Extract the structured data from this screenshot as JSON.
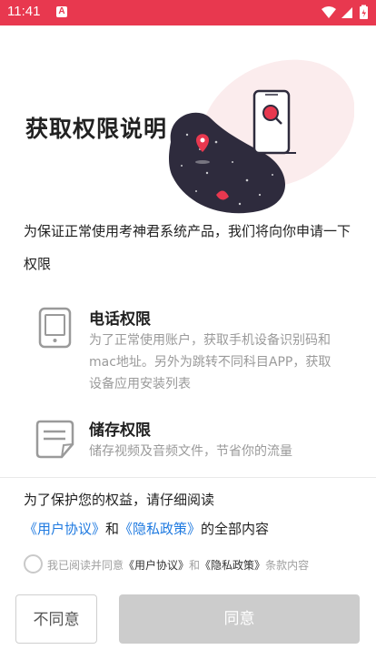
{
  "status_bar": {
    "time": "11:41",
    "app_icon_letter": "A"
  },
  "page": {
    "title": "获取权限说明"
  },
  "intro": {
    "text": "为保证正常使用考神君系统产品，我们将向你申请一下权限"
  },
  "permissions": [
    {
      "icon": "tablet-icon",
      "title": "电话权限",
      "description": "为了正常使用账户，获取手机设备识别码和mac地址。另外为跳转不同科目APP，获取设备应用安装列表"
    },
    {
      "icon": "document-icon",
      "title": "储存权限",
      "description": "储存视频及音频文件，节省你的流量"
    }
  ],
  "notice": {
    "text": "为了保护您的权益，请仔细阅读",
    "user_agreement": "《用户协议》",
    "and": "和",
    "privacy_policy": "《隐私政策》",
    "suffix": "的全部内容"
  },
  "agree_line": {
    "prefix": "我已阅读并同意",
    "user_agreement": "《用户协议》",
    "and": "和",
    "privacy_policy": "《隐私政策》",
    "suffix": "条款内容"
  },
  "buttons": {
    "disagree": "不同意",
    "agree": "同意"
  },
  "colors": {
    "status_bar": "#e8384f",
    "link": "#1f7ae0",
    "agree_disabled": "#cccccc",
    "illustration_dark": "#2e2b3d",
    "illustration_bg": "#fbeced"
  }
}
